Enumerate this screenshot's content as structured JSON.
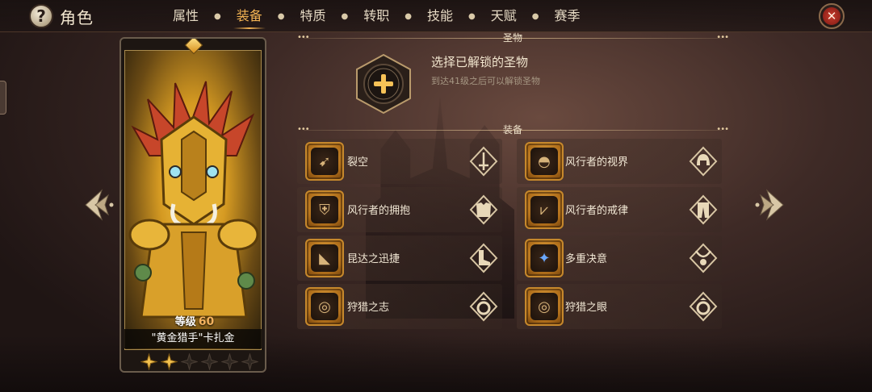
{
  "header": {
    "help_icon": "question-mark-icon",
    "title": "角色",
    "tabs": [
      {
        "label": "属性",
        "active": false
      },
      {
        "label": "装备",
        "active": true
      },
      {
        "label": "特质",
        "active": false
      },
      {
        "label": "转职",
        "active": false
      },
      {
        "label": "技能",
        "active": false
      },
      {
        "label": "天赋",
        "active": false
      },
      {
        "label": "赛季",
        "active": false
      }
    ],
    "close_icon": "close-icon"
  },
  "hero": {
    "level_label": "等级",
    "level": "60",
    "name": "\"黄金猎手\"卡扎金",
    "stars_filled": 2,
    "stars_total": 6
  },
  "relic": {
    "section_title": "圣物",
    "title": "选择已解锁的圣物",
    "subtitle": "到达41级之后可以解锁圣物"
  },
  "equipment": {
    "section_title": "装备",
    "items": [
      {
        "name": "裂空",
        "item_icon": "bow-icon",
        "glyph": "➹",
        "slot_icon": "weapon-slot-icon"
      },
      {
        "name": "风行者的视界",
        "item_icon": "hood-icon",
        "glyph": "◓",
        "slot_icon": "helmet-slot-icon"
      },
      {
        "name": "风行者的拥抱",
        "item_icon": "chest-armor-icon",
        "glyph": "⛨",
        "slot_icon": "chest-slot-icon"
      },
      {
        "name": "风行者的戒律",
        "item_icon": "leggings-icon",
        "glyph": "⩗",
        "slot_icon": "legs-slot-icon"
      },
      {
        "name": "昆达之迅捷",
        "item_icon": "boots-icon",
        "glyph": "◣",
        "slot_icon": "boots-slot-icon"
      },
      {
        "name": "多重决意",
        "item_icon": "amulet-icon",
        "glyph": "✦",
        "slot_icon": "necklace-slot-icon"
      },
      {
        "name": "狩猎之志",
        "item_icon": "ring-icon",
        "glyph": "◎",
        "slot_icon": "ring-slot-icon"
      },
      {
        "name": "狩猎之眼",
        "item_icon": "ring-icon",
        "glyph": "◎",
        "slot_icon": "ring-slot-icon"
      }
    ]
  },
  "colors": {
    "accent": "#f1b253",
    "item_frame": "#c6882c",
    "text": "#f1e7d4",
    "subtext": "#a69783"
  }
}
